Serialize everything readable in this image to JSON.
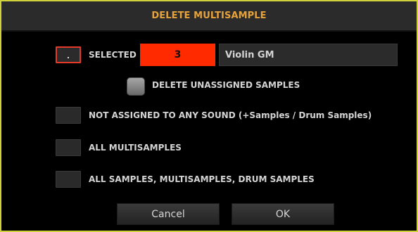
{
  "dialog": {
    "title": "DELETE MULTISAMPLE",
    "selected": {
      "label": "SELECTED",
      "checkbox_mark": ".",
      "number": "3",
      "name": "Violin GM"
    },
    "delete_unassigned_label": "DELETE UNASSIGNED SAMPLES",
    "options": [
      {
        "label": "NOT ASSIGNED TO ANY SOUND (+Samples / Drum Samples)"
      },
      {
        "label": "ALL MULTISAMPLES"
      },
      {
        "label": "ALL SAMPLES, MULTISAMPLES, DRUM SAMPLES"
      }
    ],
    "buttons": {
      "cancel": "Cancel",
      "ok": "OK"
    }
  },
  "colors": {
    "frame": "#cfd23a",
    "title": "#e6a33b",
    "selected_number_field": "#ff2a00",
    "selected_checkbox_border": "#e53a2a"
  }
}
